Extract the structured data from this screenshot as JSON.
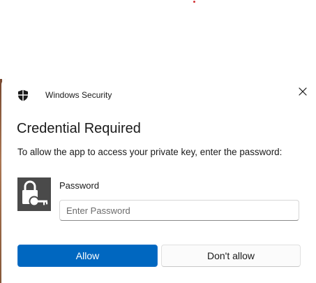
{
  "window": {
    "app_title": "Windows Security",
    "close_icon": "close-icon",
    "shield_icon": "shield-icon"
  },
  "dialog": {
    "heading": "Credential Required",
    "instruction": "To allow the app to access your private key, enter the password:",
    "key_icon": "lock-key-icon",
    "password_label": "Password",
    "password_placeholder": "Enter Password",
    "password_value": ""
  },
  "buttons": {
    "allow_label": "Allow",
    "dont_allow_label": "Don't allow"
  },
  "colors": {
    "accent": "#0067c0",
    "tile": "#4a4a4a"
  }
}
